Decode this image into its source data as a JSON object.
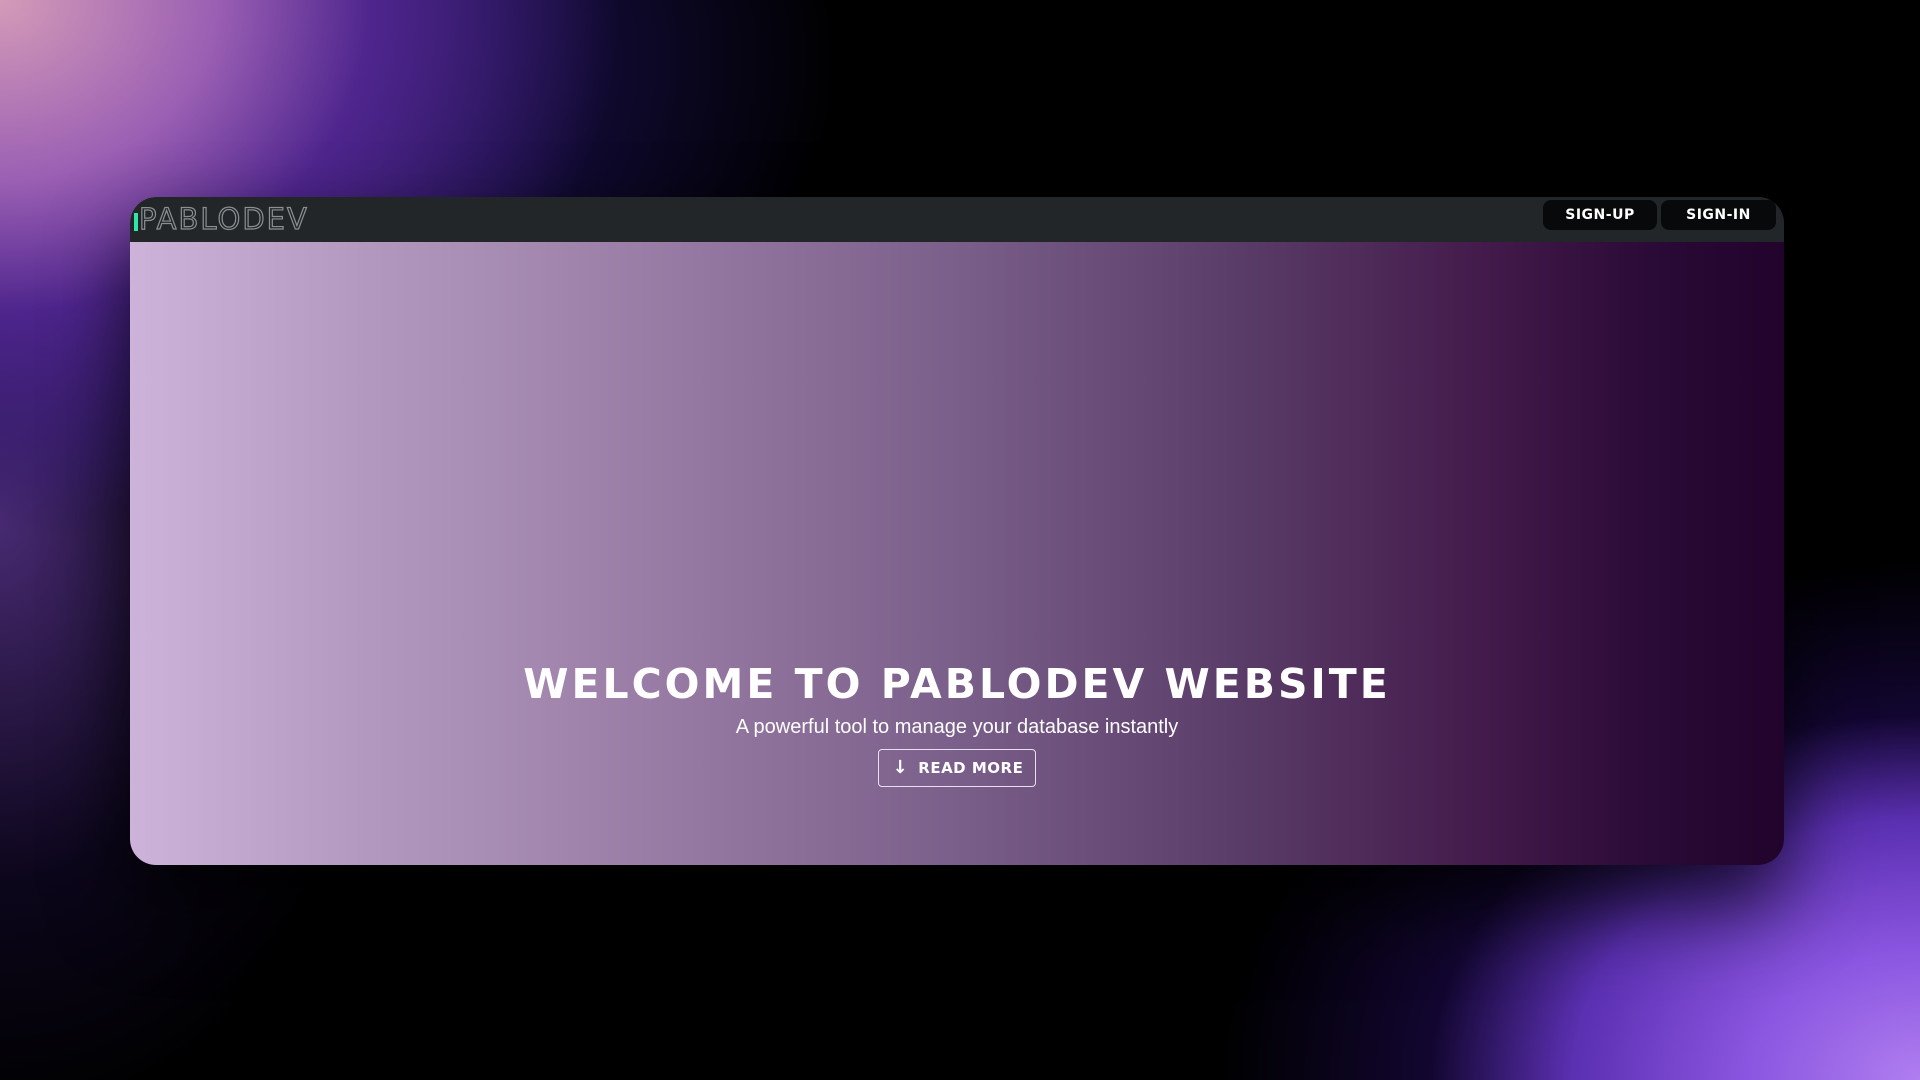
{
  "brand": {
    "logo_text": "PABLODEV"
  },
  "nav": {
    "signup_label": "SIGN-UP",
    "signin_label": "SIGN-IN"
  },
  "hero": {
    "title": "WELCOME TO PABLODEV WEBSITE",
    "subtitle": "A powerful tool to manage your database instantly",
    "read_more_label": "READ MORE",
    "read_more_icon": "arrow-down-icon"
  },
  "colors": {
    "navbar_bg": "#232629",
    "logo_accent": "#2ee6a8",
    "button_bg": "#08090a",
    "hero_gradient_start": "#cdb3d9",
    "hero_gradient_end": "#21032c"
  }
}
